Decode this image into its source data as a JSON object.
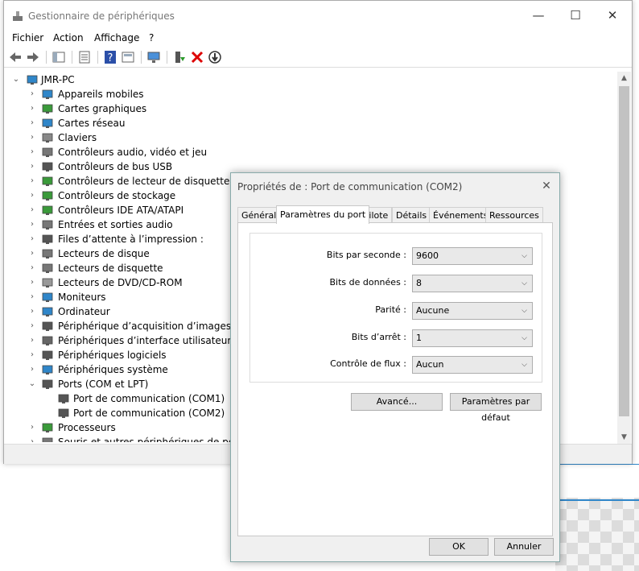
{
  "window": {
    "title": "Gestionnaire de périphériques",
    "minimize": "—",
    "maximize": "☐",
    "close": "✕"
  },
  "menu": [
    "Fichier",
    "Action",
    "Affichage",
    "?"
  ],
  "tree": {
    "root": "JMR-PC",
    "items": [
      {
        "label": "Appareils mobiles",
        "icon": "phone-icon"
      },
      {
        "label": "Cartes graphiques",
        "icon": "display-adapter-icon"
      },
      {
        "label": "Cartes réseau",
        "icon": "network-icon"
      },
      {
        "label": "Claviers",
        "icon": "keyboard-icon"
      },
      {
        "label": "Contrôleurs audio, vidéo et jeu",
        "icon": "speaker-icon"
      },
      {
        "label": "Contrôleurs de bus USB",
        "icon": "usb-icon"
      },
      {
        "label": "Contrôleurs de lecteur de disquette",
        "icon": "controller-icon"
      },
      {
        "label": "Contrôleurs de stockage",
        "icon": "storage-icon"
      },
      {
        "label": "Contrôleurs IDE ATA/ATAPI",
        "icon": "ide-icon"
      },
      {
        "label": "Entrées et sorties audio",
        "icon": "audio-icon"
      },
      {
        "label": "Files d’attente à l’impression :",
        "icon": "printer-icon"
      },
      {
        "label": "Lecteurs de disque",
        "icon": "disk-icon"
      },
      {
        "label": "Lecteurs de disquette",
        "icon": "floppy-icon"
      },
      {
        "label": "Lecteurs de DVD/CD-ROM",
        "icon": "dvd-icon"
      },
      {
        "label": "Moniteurs",
        "icon": "monitor-icon"
      },
      {
        "label": "Ordinateur",
        "icon": "computer-icon"
      },
      {
        "label": "Périphérique d’acquisition d’images",
        "icon": "camera-icon"
      },
      {
        "label": "Périphériques d’interface utilisateur",
        "icon": "hid-icon"
      },
      {
        "label": "Périphériques logiciels",
        "icon": "software-device-icon"
      },
      {
        "label": "Périphériques système",
        "icon": "system-icon"
      },
      {
        "label": "Ports (COM et LPT)",
        "icon": "port-icon",
        "expanded": true
      },
      {
        "label": "Port de communication (COM1)",
        "icon": "port-icon",
        "child": true
      },
      {
        "label": "Port de communication (COM2)",
        "icon": "port-icon",
        "child": true
      },
      {
        "label": "Processeurs",
        "icon": "cpu-icon"
      },
      {
        "label": "Souris et autres périphériques de pointage",
        "icon": "mouse-icon"
      }
    ]
  },
  "dialog": {
    "title": "Propriétés de : Port de communication (COM2)",
    "close": "✕",
    "tabs": [
      "Général",
      "Paramètres du port",
      "Pilote",
      "Détails",
      "Événements",
      "Ressources"
    ],
    "active_tab": "Paramètres du port",
    "fields": [
      {
        "label": "Bits par seconde :",
        "value": "9600"
      },
      {
        "label": "Bits de données :",
        "value": "8"
      },
      {
        "label": "Parité :",
        "value": "Aucune"
      },
      {
        "label": "Bits d’arrêt :",
        "value": "1"
      },
      {
        "label": "Contrôle de flux :",
        "value": "Aucun"
      }
    ],
    "advanced_button": "Avancé...",
    "defaults_button": "Paramètres par défaut",
    "ok_button": "OK",
    "cancel_button": "Annuler"
  },
  "colors": {
    "accent": "#2f86c9"
  }
}
